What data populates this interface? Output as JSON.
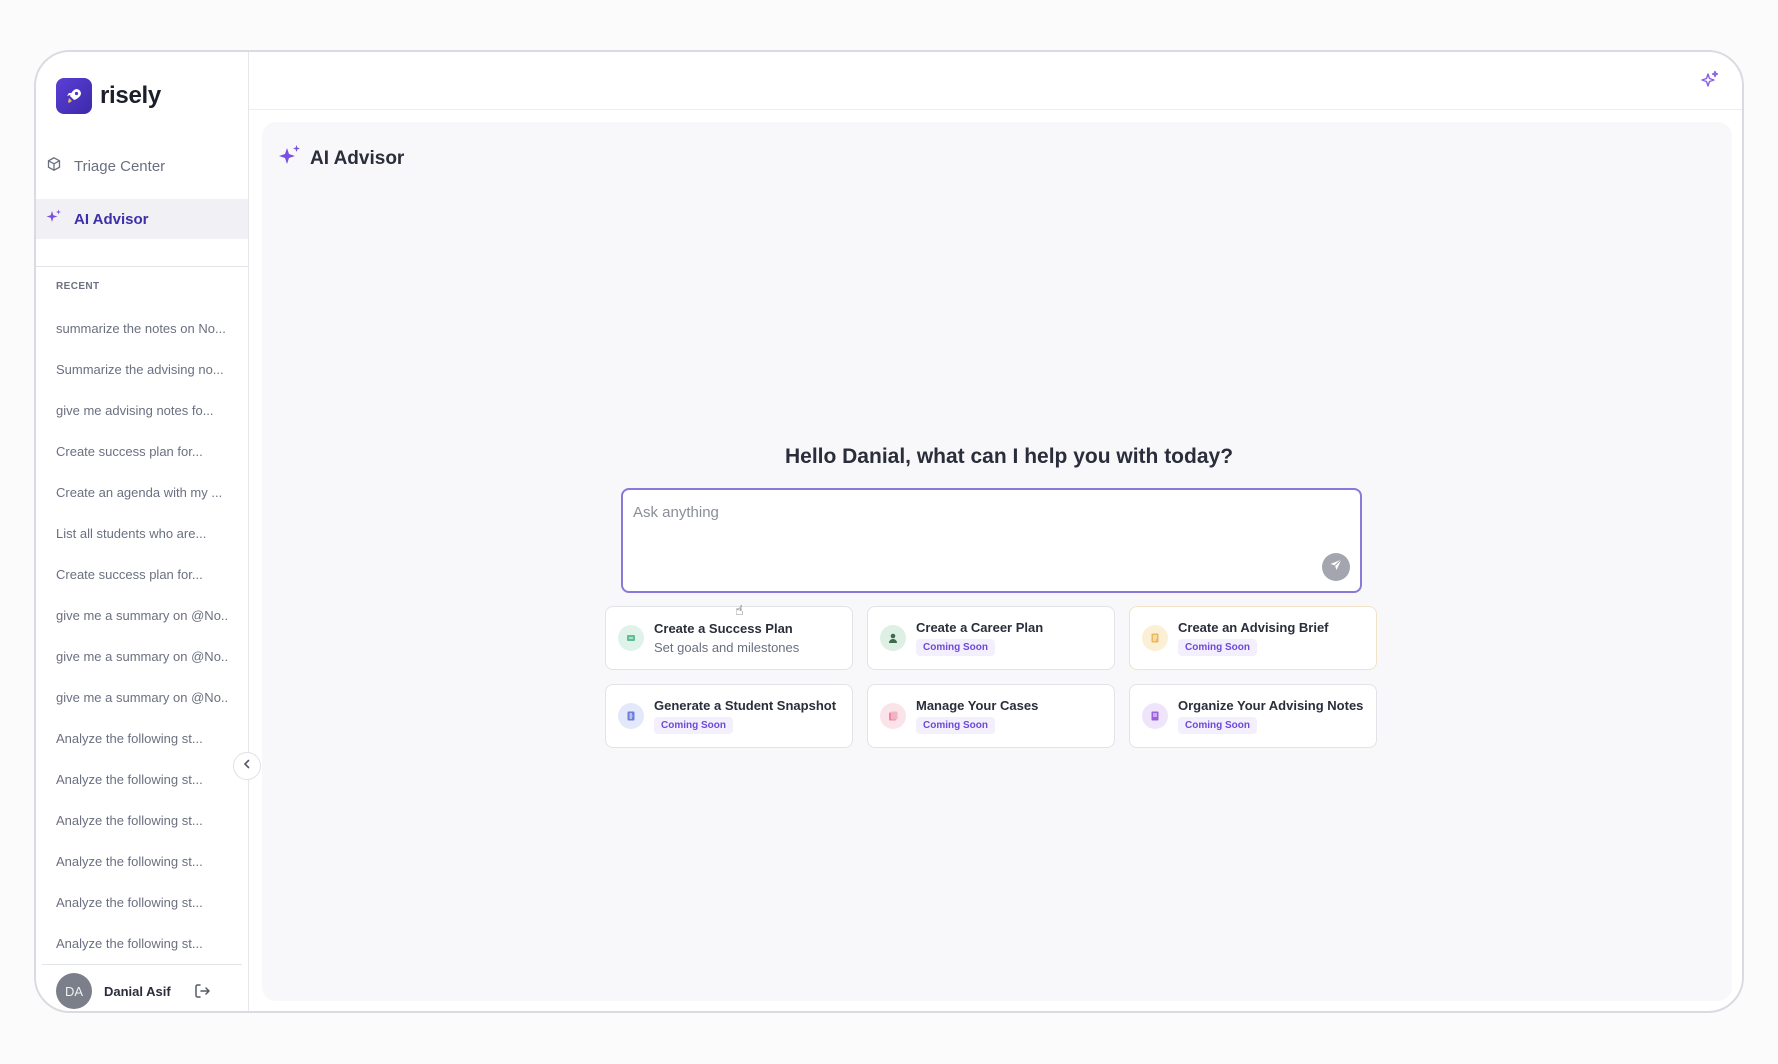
{
  "app": {
    "name": "risely"
  },
  "sidebar": {
    "nav": [
      {
        "label": "Triage Center",
        "icon": "cube-icon"
      },
      {
        "label": "AI Advisor",
        "icon": "sparkle-icon",
        "active": true
      }
    ],
    "recent_label": "RECENT",
    "recent": [
      "summarize the notes on No...",
      "Summarize the advising no...",
      "give me advising notes fo...",
      "Create success plan for...",
      "Create an agenda with my ...",
      "List all students who are...",
      "Create success plan for...",
      "give me a summary on @No...",
      "give me a summary on @No...",
      "give me a summary on @No...",
      "Analyze the following st...",
      "Analyze the following st...",
      "Analyze the following st...",
      "Analyze the following st...",
      "Analyze the following st...",
      "Analyze the following st..."
    ],
    "user": {
      "initials": "DA",
      "name": "Danial Asif"
    }
  },
  "main": {
    "title": "AI Advisor",
    "greeting": "Hello Danial, what can I help you with today?",
    "ask_placeholder": "Ask anything",
    "cards": [
      {
        "title": "Create a Success Plan",
        "subtitle": "Set goals and milestones"
      },
      {
        "title": "Create a Career Plan",
        "badge": "Coming Soon"
      },
      {
        "title": "Create an Advising Brief",
        "badge": "Coming Soon"
      },
      {
        "title": "Generate a Student Snapshot",
        "badge": "Coming Soon"
      },
      {
        "title": "Manage Your Cases",
        "badge": "Coming Soon"
      },
      {
        "title": "Organize Your Advising Notes",
        "badge": "Coming Soon"
      }
    ]
  },
  "colors": {
    "brand": "#4b34c4",
    "accent_purple": "#7b4fe0",
    "badge_text": "#6d4ad8",
    "badge_bg": "#f3effd",
    "input_border": "#8b78d9"
  }
}
